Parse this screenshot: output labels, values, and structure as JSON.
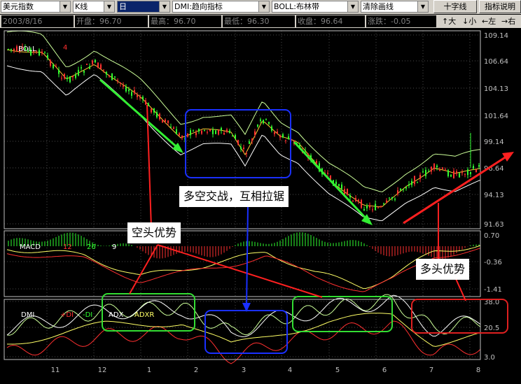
{
  "toolbar": {
    "index_select": "美元指数",
    "chart_type_select": "K线",
    "period_select": "日",
    "indicator_select_1": "DMI:趋向指标",
    "indicator_select_2": "BOLL:布林带",
    "clear_select": "清除画线",
    "crosshair_button": "十字线",
    "help_button": "指标说明"
  },
  "infobar": {
    "date": "2003/8/16",
    "open": "开盘：96.70",
    "high": "最高：96.70",
    "low": "最低：96.30",
    "close": "收盘：96.64",
    "change": "涨跌：-0.05",
    "zoom_in": "↑大",
    "zoom_out": "↓小",
    "pan_left": "←左",
    "pan_right": "→右"
  },
  "price_panel": {
    "label": "BOLL",
    "number": "4",
    "ticks": [
      "109.14",
      "106.64",
      "104.13",
      "101.64",
      "99.14",
      "96.64",
      "94.13",
      "91.63"
    ]
  },
  "macd_panel": {
    "label": "MACD",
    "p1": "12",
    "p2": "26",
    "p3": "9",
    "ticks": [
      "0.70",
      "-0.36",
      "-1.41"
    ]
  },
  "dmi_panel": {
    "label": "DMI",
    "pdi": "+DI",
    "mdi": "-DI",
    "adx": "ADX",
    "adxr": "ADXR",
    "ticks": [
      "38.0",
      "20.5",
      "3.0"
    ]
  },
  "x_axis": [
    "11",
    "12",
    "1",
    "2",
    "3",
    "4",
    "5",
    "6",
    "7",
    "8"
  ],
  "annotations": {
    "bear": "空头优势",
    "mixed": "多空交战，互相拉锯",
    "bull": "多头优势"
  },
  "colors": {
    "panel_border": "#c0c0c0",
    "grid": "#4a4a4a",
    "bull": "#ff3030",
    "bear": "#30ff30",
    "green_box": "#33dd33",
    "blue_box": "#1a30ff",
    "red_box": "#e02020"
  }
}
